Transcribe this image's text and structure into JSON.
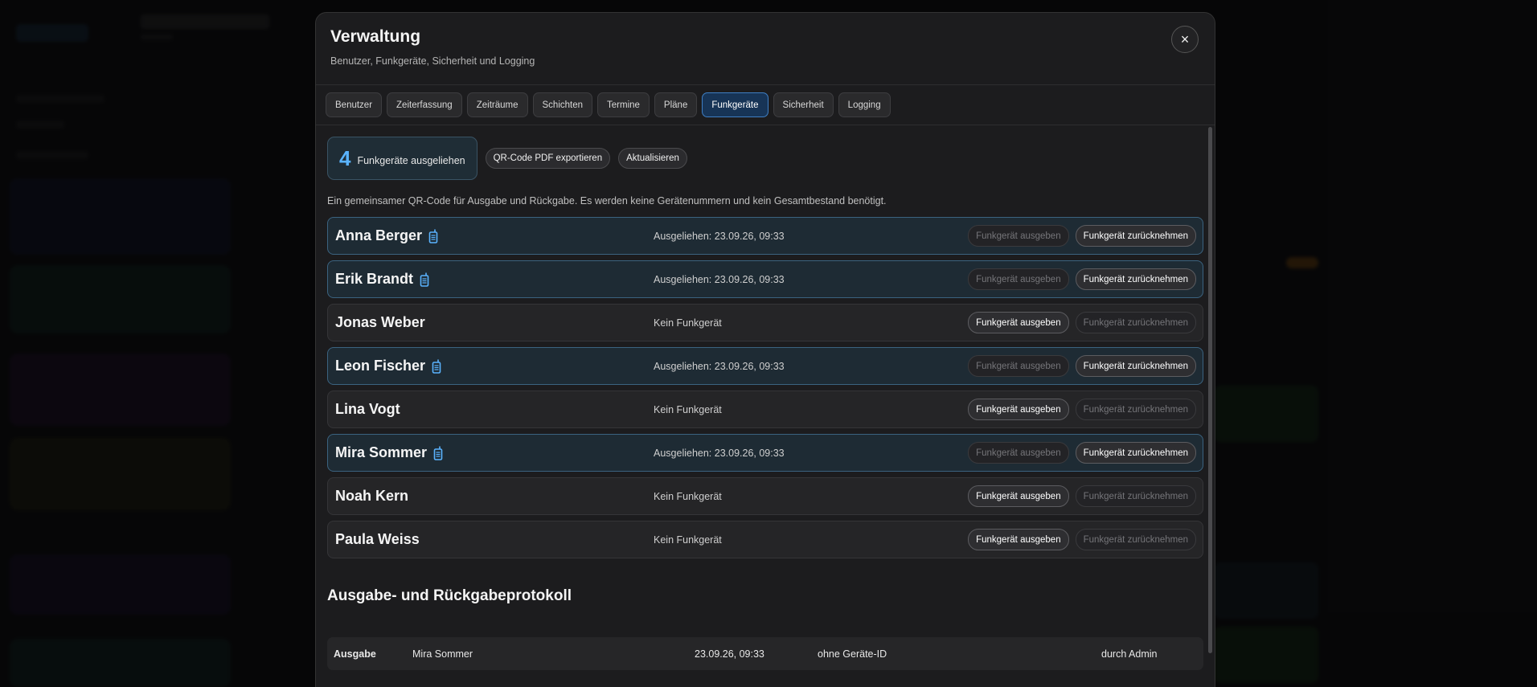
{
  "modal": {
    "title": "Verwaltung",
    "subtitle": "Benutzer, Funkgeräte, Sicherheit und Logging",
    "close_label": "×"
  },
  "tabs": [
    {
      "label": "Benutzer",
      "active": false
    },
    {
      "label": "Zeiterfassung",
      "active": false
    },
    {
      "label": "Zeiträume",
      "active": false
    },
    {
      "label": "Schichten",
      "active": false
    },
    {
      "label": "Termine",
      "active": false
    },
    {
      "label": "Pläne",
      "active": false
    },
    {
      "label": "Funkgeräte",
      "active": true
    },
    {
      "label": "Sicherheit",
      "active": false
    },
    {
      "label": "Logging",
      "active": false
    }
  ],
  "stats": {
    "count": "4",
    "label": "Funkgeräte ausgeliehen",
    "export_label": "QR-Code PDF exportieren",
    "refresh_label": "Aktualisieren"
  },
  "info_text": "Ein gemeinsamer QR-Code für Ausgabe und Rückgabe. Es werden keine Gerätenummern und kein Gesamtbestand benötigt.",
  "actions": {
    "issue_label": "Funkgerät ausgeben",
    "return_label": "Funkgerät zurücknehmen"
  },
  "people": [
    {
      "name": "Anna Berger",
      "status": "Ausgeliehen: 23.09.26, 09:33",
      "has_device": true
    },
    {
      "name": "Erik Brandt",
      "status": "Ausgeliehen: 23.09.26, 09:33",
      "has_device": true
    },
    {
      "name": "Jonas Weber",
      "status": "Kein Funkgerät",
      "has_device": false
    },
    {
      "name": "Leon Fischer",
      "status": "Ausgeliehen: 23.09.26, 09:33",
      "has_device": true
    },
    {
      "name": "Lina Vogt",
      "status": "Kein Funkgerät",
      "has_device": false
    },
    {
      "name": "Mira Sommer",
      "status": "Ausgeliehen: 23.09.26, 09:33",
      "has_device": true
    },
    {
      "name": "Noah Kern",
      "status": "Kein Funkgerät",
      "has_device": false
    },
    {
      "name": "Paula Weiss",
      "status": "Kein Funkgerät",
      "has_device": false
    }
  ],
  "log": {
    "title": "Ausgabe- und Rückgabeprotokoll",
    "entries": [
      {
        "type": "Ausgabe",
        "name": "Mira Sommer",
        "time": "23.09.26, 09:33",
        "device": "ohne Geräte-ID",
        "by": "durch Admin"
      }
    ]
  },
  "colors": {
    "accent": "#5ab3ff",
    "active_tab_bg": "#173456",
    "device_row_bg": "#1e2b34"
  },
  "icons": {
    "close": "close-icon",
    "radio": "radio-device-icon"
  }
}
